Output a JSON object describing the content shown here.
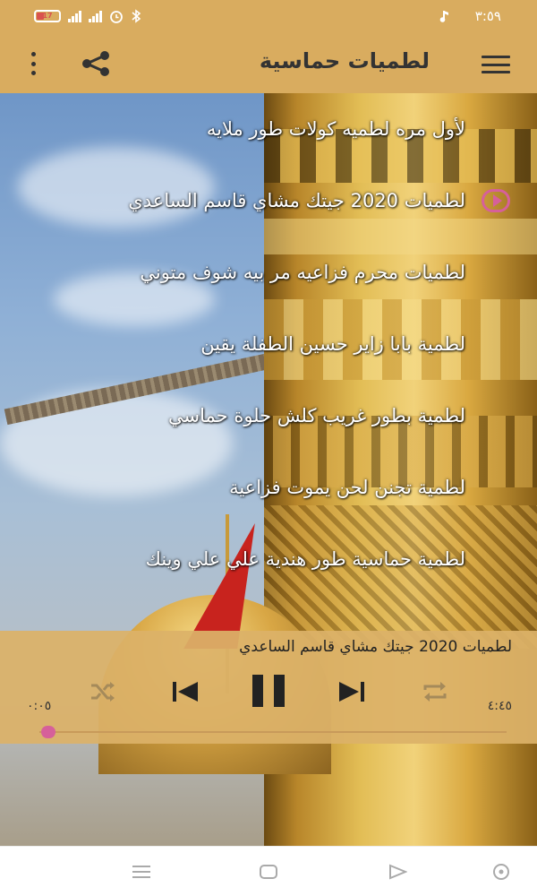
{
  "status_bar": {
    "battery_level": "17",
    "time": "٣:٥٩",
    "icons": [
      "battery-icon",
      "signal-icon",
      "signal-icon",
      "alarm-icon",
      "bluetooth-icon",
      "music-note-icon"
    ]
  },
  "app_bar": {
    "title": "لطميات حماسية",
    "icons": [
      "menu-icon",
      "share-icon",
      "more-vert-icon"
    ]
  },
  "songs": [
    {
      "title": "لأول مره لطميه كولات طور ملايه",
      "playing": false
    },
    {
      "title": "لطميات 2020 جيتك مشاي قاسم الساعدي",
      "playing": true
    },
    {
      "title": "لطميات محرم فزاعيه مر بيه شوف متوني",
      "playing": false
    },
    {
      "title": "لطمية بابا زاير حسين الطفلة يقين",
      "playing": false
    },
    {
      "title": "لطمية بطور غريب كلش حلوة حماسي",
      "playing": false
    },
    {
      "title": "لطمية تجنن لحن يموت فزاعية",
      "playing": false
    },
    {
      "title": "لطمية حماسية طور هندية علي علي وينك",
      "playing": false
    }
  ],
  "player": {
    "now_playing": "لطميات 2020 جيتك مشاي قاسم الساعدي",
    "elapsed": "٠:٠٥",
    "duration": "٤:٤٥",
    "progress": 0.02,
    "accent_color": "#d6609a",
    "controls": [
      "shuffle-icon",
      "skip-previous-icon",
      "pause-icon",
      "skip-next-icon",
      "repeat-icon"
    ]
  },
  "nav_bar": {
    "icons": [
      "recent-apps-icon",
      "home-icon",
      "back-icon",
      "assistant-icon"
    ]
  },
  "colors": {
    "bar": "#d9ac5f",
    "player_panel": "#dbb268"
  }
}
